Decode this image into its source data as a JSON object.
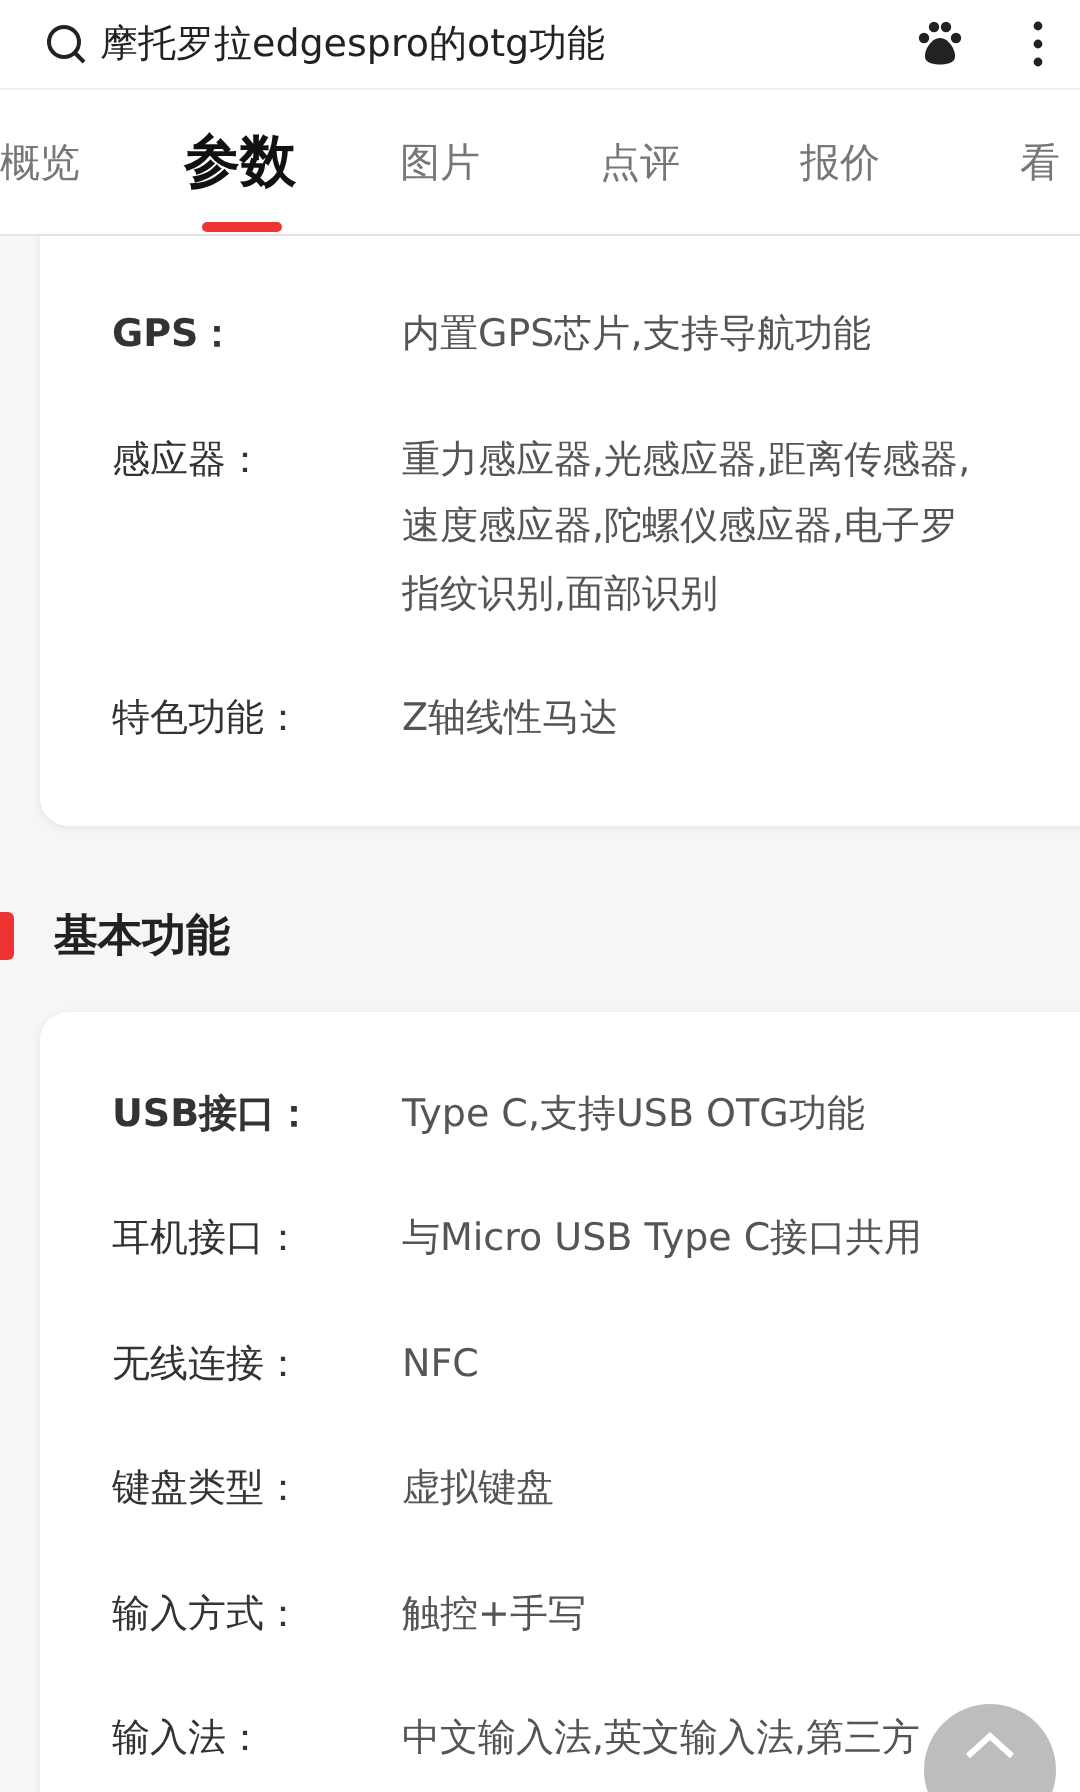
{
  "search": {
    "query": "摩托罗拉edgespro的otg功能"
  },
  "tabs": [
    {
      "label": "概览",
      "selected": false
    },
    {
      "label": "参数",
      "selected": true
    },
    {
      "label": "图片",
      "selected": false
    },
    {
      "label": "点评",
      "selected": false
    },
    {
      "label": "报价",
      "selected": false
    },
    {
      "label": "看",
      "selected": false
    }
  ],
  "sections": [
    {
      "rows": [
        {
          "label": "GPS：",
          "lines": [
            "内置GPS芯片,支持导航功能"
          ],
          "bold": true
        },
        {
          "label": "感应器：",
          "lines": [
            "重力感应器,光感应器,距离传感器,",
            "速度感应器,陀螺仪感应器,电子罗",
            "指纹识别,面部识别"
          ],
          "bold": false
        },
        {
          "label": "特色功能：",
          "lines": [
            "Z轴线性马达"
          ],
          "bold": false
        }
      ]
    },
    {
      "title": "基本功能",
      "rows": [
        {
          "label": "USB接口：",
          "lines": [
            "Type C,支持USB OTG功能"
          ],
          "bold": true
        },
        {
          "label": "耳机接口：",
          "lines": [
            "与Micro USB Type C接口共用"
          ],
          "bold": false
        },
        {
          "label": "无线连接：",
          "lines": [
            "NFC"
          ],
          "bold": false
        },
        {
          "label": "键盘类型：",
          "lines": [
            "虚拟键盘"
          ],
          "bold": false
        },
        {
          "label": "输入方式：",
          "lines": [
            "触控+手写"
          ],
          "bold": false
        },
        {
          "label": "输入法：",
          "lines": [
            "中文输入法,英文输入法,第三方"
          ],
          "bold": false
        }
      ]
    }
  ]
}
